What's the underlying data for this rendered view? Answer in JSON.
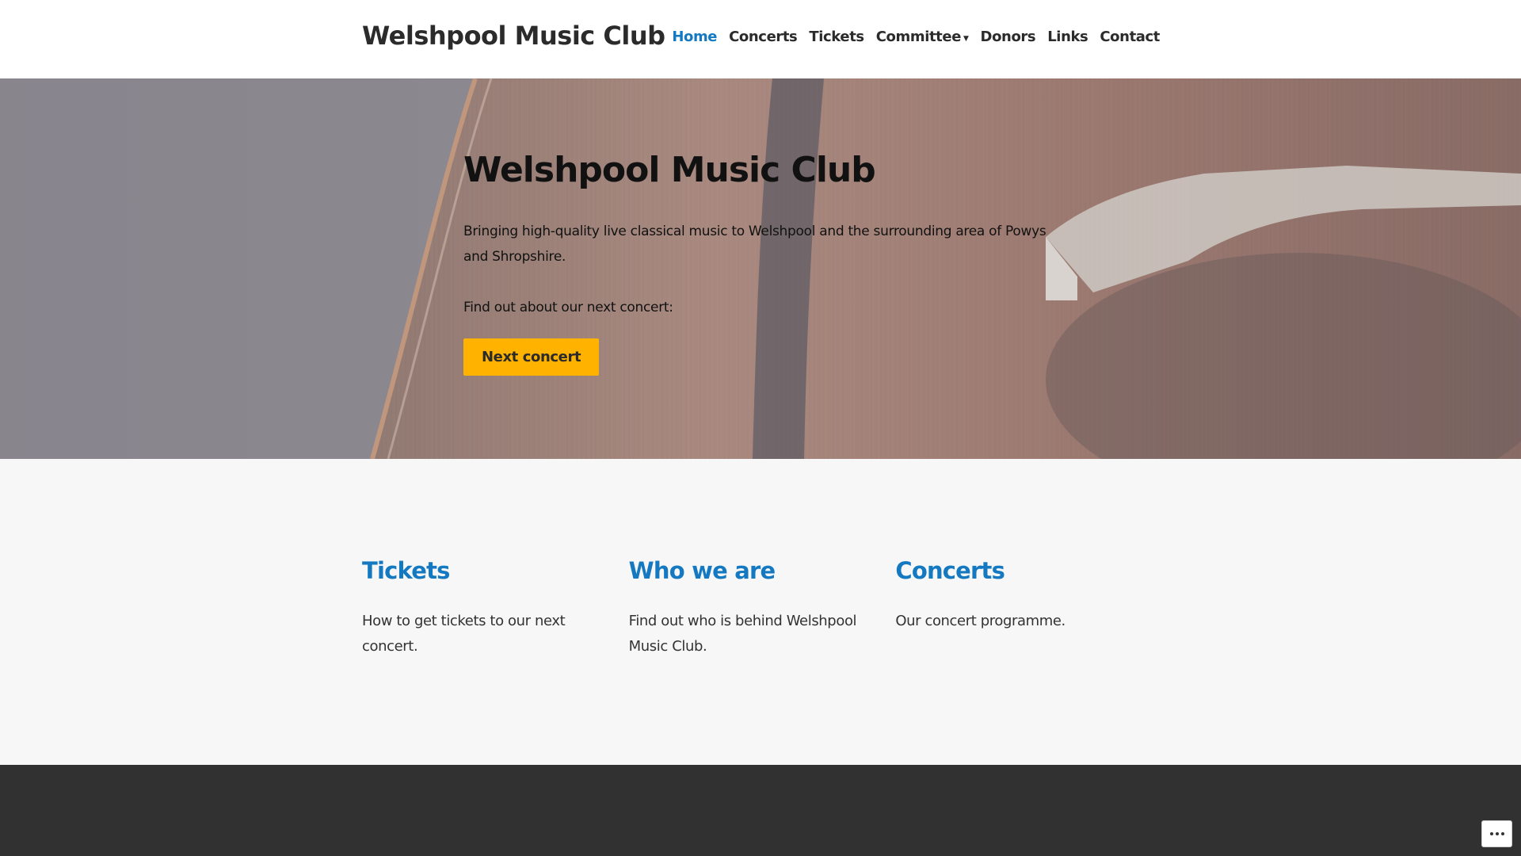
{
  "header": {
    "site_title": "Welshpool Music Club",
    "nav": [
      {
        "label": "Home",
        "active": true
      },
      {
        "label": "Concerts",
        "active": false
      },
      {
        "label": "Tickets",
        "active": false
      },
      {
        "label": "Committee",
        "active": false,
        "has_dropdown": true
      },
      {
        "label": "Donors",
        "active": false
      },
      {
        "label": "Links",
        "active": false
      },
      {
        "label": "Contact",
        "active": false
      }
    ],
    "dropdown_icon": "caret-down-icon"
  },
  "hero": {
    "title": "Welshpool Music Club",
    "text": "Bringing high-quality live classical music to Welshpool and the surrounding area of Powys and Shropshire.",
    "text2": "Find out about our next concert:",
    "button_label": "Next concert",
    "background": "cello-photo"
  },
  "features": [
    {
      "title": "Tickets",
      "text": "How to get tickets to our next concert."
    },
    {
      "title": "Who we are",
      "text": "Find out who is behind Welshpool Music Club."
    },
    {
      "title": "Concerts",
      "text": "Our concert programme."
    }
  ],
  "footer": {
    "more_icon": "ellipsis-icon"
  },
  "colors": {
    "accent": "#1479c1",
    "button": "#ffb300",
    "text": "#2b2b2b",
    "page_background": "#f7f7f7",
    "footer_background": "#313131"
  }
}
